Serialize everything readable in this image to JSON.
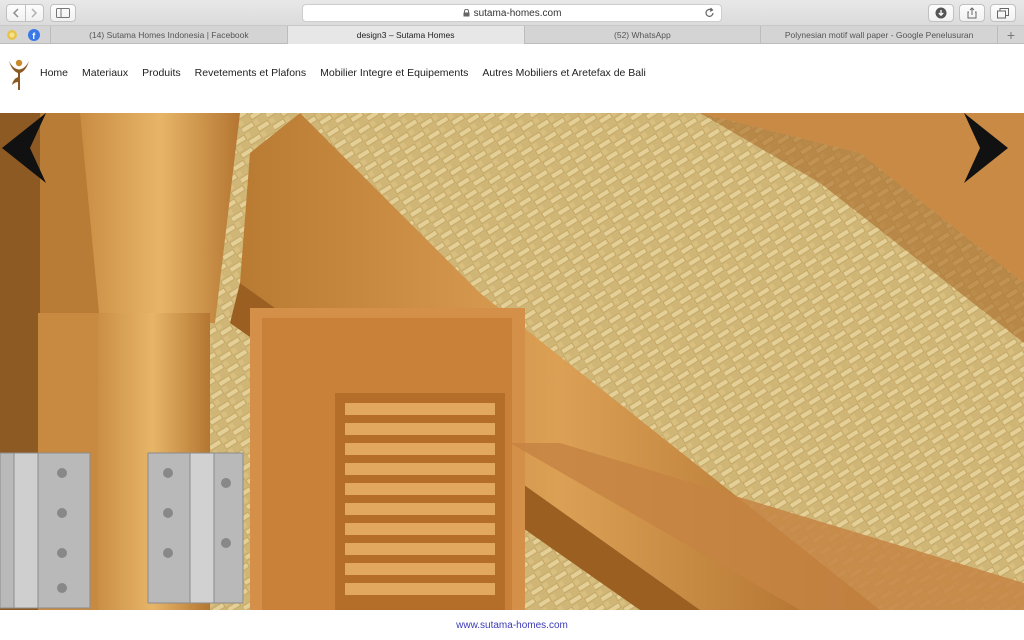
{
  "browser": {
    "url": "sutama-homes.com",
    "tabs": [
      {
        "label": "(14) Sutama Homes Indonesia | Facebook",
        "active": false
      },
      {
        "label": "design3 – Sutama Homes",
        "active": true
      },
      {
        "label": "(52) WhatsApp",
        "active": false
      },
      {
        "label": "Polynesian motif wall paper - Google Penelusuran",
        "active": false
      }
    ],
    "new_tab": "+"
  },
  "site": {
    "nav": [
      "Home",
      "Materiaux",
      "Produits",
      "Revetements et Plafons",
      "Mobilier Integre et Equipements",
      "Autres Mobiliers et Aretefax de Bali"
    ]
  },
  "hero": {
    "accent_wood": "#c8893c",
    "weave_color": "#d9c283"
  },
  "footer": {
    "link": "www.sutama-homes.com"
  }
}
